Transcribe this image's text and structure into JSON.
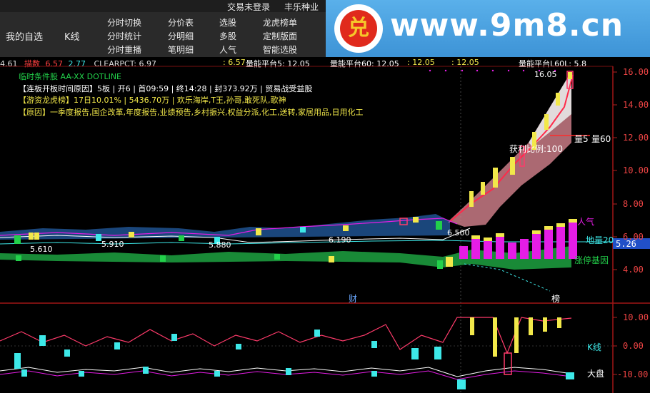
{
  "topbar": {
    "trade_status": "交易未登录",
    "brand": "丰乐种业",
    "my_watchlist": "我的自选",
    "kline": "K线",
    "menu": [
      [
        "分时切换",
        "分时统计",
        "分时重播"
      ],
      [
        "分价表",
        "分明细",
        "笔明细"
      ],
      [
        "选股",
        "多股",
        "人气"
      ],
      [
        "龙虎榜单",
        "定制版面",
        "智能选股"
      ]
    ]
  },
  "watermark": {
    "text": "www.9m8.cn",
    "seal": "兑"
  },
  "indicator_line": {
    "v1": "4.61",
    "label": "描数",
    "v2": "6.57",
    "v3": "2.77",
    "clearpct": "CLEARPCT: 6.97",
    "v4": ": 6.57",
    "l1": "量能平台5: 12.05",
    "l2": "量能平台60: 12.05",
    "v5": ": 12.05",
    "v6": ": 12.05",
    "l3": "量能平台L60L: 5.8"
  },
  "info": {
    "line1": "临时条件股 AA-XX DOTLINE",
    "line2": "【连板开板时间原因】5板 | 开6 | 首09:59 | 终14:28 | 封373.92万 | 贸易战受益股",
    "line3": "【游资龙虎榜】17日10.01% | 5436.70万 | 欢乐海岸,T王,孙哥,敢死队,歌神",
    "line4": "【原因】一季度报告,国企改革,年度报告,业绩预告,乡村振兴,权益分派,化工,送转,家居用品,日用化工"
  },
  "annotations": {
    "high": "16.05",
    "profit": "获利比例:100",
    "vol5": "量5",
    "vol60": "量60",
    "popularity": "人气",
    "earth20": "地量20",
    "limitup": "涨停基因",
    "p6500": "6.500",
    "p5610": "5.610",
    "p5910": "5.910",
    "p5880": "5.880",
    "p6190": "6.190",
    "cai": "财",
    "bang": "榜",
    "kline_lbl": "K线",
    "dapan": "大盘",
    "current_price": "5.26"
  },
  "main_axis": [
    "16.00",
    "14.00",
    "12.00",
    "10.00",
    "8.00",
    "6.00",
    "4.00"
  ],
  "sub_axis": [
    "10.00",
    "0.00",
    "-10.00"
  ],
  "colors": {
    "up": "#ff3b6b",
    "down": "#3de8e8",
    "yellow": "#f2e84a",
    "magenta": "#e51de5",
    "green": "#22b84a",
    "blue": "#2f7fe0",
    "axis": "#b02020"
  }
}
